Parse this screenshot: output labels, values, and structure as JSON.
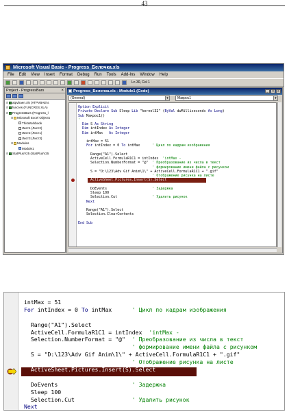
{
  "page": {
    "number": "43"
  },
  "vb": {
    "title": "Microsoft Visual Basic - Progress_Белочка.xls",
    "menu": [
      "File",
      "Edit",
      "View",
      "Insert",
      "Format",
      "Debug",
      "Run",
      "Tools",
      "Add-Ins",
      "Window",
      "Help"
    ],
    "position": "Ln 30, Col 1"
  },
  "project": {
    "title": "Project - ProgressBars",
    "items": [
      {
        "label": "atpvbaen.xls (ATPVBAEN.",
        "indent": 0,
        "icon": "xl"
      },
      {
        "label": "funcres (FUNCRES.XLA)",
        "indent": 0,
        "icon": "xl"
      },
      {
        "label": "ProgressBars (Progress_l",
        "indent": 0,
        "icon": "xl"
      },
      {
        "label": "Microsoft Excel Objects",
        "indent": 1,
        "icon": "fd"
      },
      {
        "label": "ThisWorkbook",
        "indent": 2,
        "icon": "sh"
      },
      {
        "label": "Лист1 (Лист2)",
        "indent": 2,
        "icon": "sh"
      },
      {
        "label": "Лист2 (Лист1)",
        "indent": 2,
        "icon": "sh"
      },
      {
        "label": "Лист3 (Лист3)",
        "indent": 2,
        "icon": "sh"
      },
      {
        "label": "Modules",
        "indent": 1,
        "icon": "fd"
      },
      {
        "label": "Module1",
        "indent": 2,
        "icon": "md"
      },
      {
        "label": "StatPlusV25 (StatPlusV25",
        "indent": 0,
        "icon": "xl"
      }
    ]
  },
  "code_window": {
    "title": "Progress_Белочка.xls - Module1 (Code)",
    "combo_left": "(General)",
    "combo_right": "Макрос1",
    "lines": [
      "Option Explicit",
      "Private Declare Sub Sleep Lib \"kernel32\" (ByVal dwMilliseconds As Long)",
      "Sub Макрос1()",
      "'",
      "  Dim S As String",
      "  Dim intIndex As Integer",
      "  Dim intMax   As Integer",
      "",
      "    intMax = 51",
      "    For intIndex = 0 To intMax      ' Цикл по кадрам изображения",
      "",
      "      Range(\"A1\").Select",
      "      ActiveCell.FormulaR1C1 = intIndex  'intMax -",
      "      Selection.NumberFormat = \"@\"  ' Преобразование из числа в текст",
      "                                    ' формирование имени файла с рисунком",
      "      S = \"D:\\123\\Adv Gif Anim\\1\\\" + ActiveCell.FormulaR1C1 + \".gif\"",
      "                                    ' Отображение рисунка на листе",
      "      ActiveSheet.Pictures.Insert(S).Select",
      "",
      "      DoEvents                      ' Задержка",
      "      Sleep 100",
      "      Selection.Cut                 ' Удалить рисунок",
      "    Next",
      "",
      "    Range(\"A1\").Select",
      "    Selection.ClearContents",
      "",
      "End Sub"
    ],
    "highlight_index": 17
  },
  "zoom": {
    "lines": [
      "intMax = 51",
      "For intIndex = 0 To intMax      ' Цикл по кадрам изображения",
      "",
      "  Range(\"A1\").Select",
      "  ActiveCell.FormulaR1C1 = intIndex  'intMax -",
      "  Selection.NumberFormat = \"@\"  ' Преобразование из числа в текст",
      "                                ' формирование имени файла с рисунком",
      "  S = \"D:\\123\\Adv Gif Anim\\1\\\" + ActiveCell.FormulaR1C1 + \".gif\"",
      "                                ' Отображение рисунка на листе",
      "  ActiveSheet.Pictures.Insert(S).Select",
      "",
      "  DoEvents                      ' Задержка",
      "  Sleep 100",
      "  Selection.Cut                 ' Удалить рисунок",
      "Next"
    ],
    "highlight_index": 9
  },
  "colors": {
    "highlight": "#5a0f08",
    "keyword": "#00007f",
    "comment": "#007f00",
    "titlebar": "#0a246a"
  }
}
